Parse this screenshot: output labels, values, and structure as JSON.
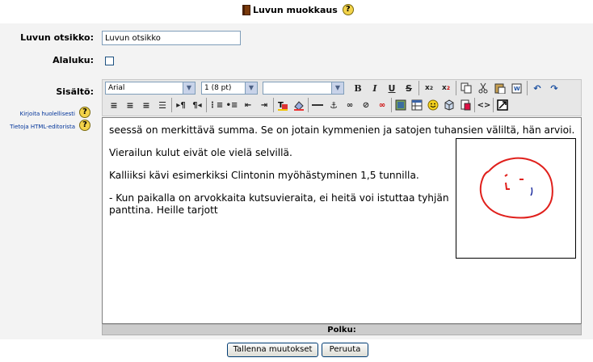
{
  "page": {
    "title": "Luvun muokkaus",
    "book_icon": "book-icon",
    "help_glyph": "?"
  },
  "form": {
    "chapter_title_label": "Luvun otsikko:",
    "chapter_title_value": "Luvun otsikko",
    "subchapter_label": "Alaluku:",
    "content_label": "Sisältö:",
    "help_link_1": "Kirjoita huolellisesti",
    "help_link_2": "Tietoja HTML-editorista"
  },
  "toolbar": {
    "font_family": "Arial",
    "font_size": "1 (8 pt)",
    "format_block": "",
    "row1_icons": [
      "bold-icon",
      "italic-icon",
      "underline-icon",
      "strikethrough-icon",
      "subscript-icon",
      "superscript-icon",
      "copy-icon",
      "cut-icon",
      "paste-icon",
      "paste-word-icon",
      "undo-icon",
      "redo-icon"
    ],
    "row2_icons": [
      "align-left-icon",
      "align-center-icon",
      "align-right-icon",
      "justify-icon",
      "ltr-icon",
      "rtl-icon",
      "ordered-list-icon",
      "unordered-list-icon",
      "outdent-icon",
      "indent-icon",
      "text-color-icon",
      "background-color-icon",
      "horizontal-rule-icon",
      "anchor-icon",
      "link-icon",
      "unlink-icon",
      "nolink-icon",
      "image-icon",
      "table-icon",
      "smiley-icon",
      "special-char-icon",
      "search-replace-icon",
      "html-source-icon",
      "fullscreen-icon"
    ]
  },
  "editor": {
    "paragraphs": [
      "seessä on merkittävä summa. Se on jotain kymmenien ja satojen tuhansien väliltä, hän arvioi.",
      "Vierailun kulut eivät ole vielä selvillä.",
      "Kalliiksi kävi esimerkiksi Clintonin myöhästyminen 1,5 tunnilla.",
      "- Kun paikalla on arvokkaita kutsuvieraita, ei heitä voi istuttaa tyhjän panttina. Heille tarjott"
    ],
    "image_icon": "smiley-drawing",
    "path_label": "Polku:"
  },
  "buttons": {
    "save": "Tallenna muutokset",
    "cancel": "Peruuta"
  },
  "colors": {
    "panel_bg": "#f3f3f3",
    "drawing_red": "#e0201c",
    "drawing_blue": "#2030a0"
  }
}
